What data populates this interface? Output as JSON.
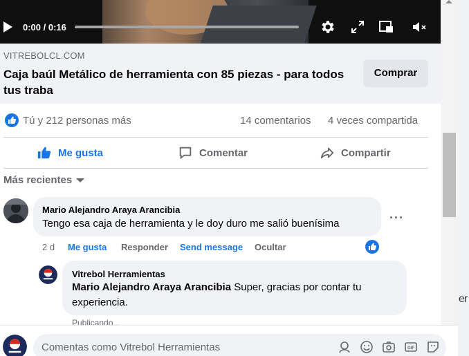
{
  "video": {
    "time": "0:00 / 0:16",
    "progress": 0.0
  },
  "link_preview": {
    "domain": "VITREBOLCL.COM",
    "title": "Caja baúl Metálico de herramienta con 85 piezas - para todos tus traba",
    "buy_label": "Comprar"
  },
  "stats": {
    "reactions_text": "Tú y 212 personas más",
    "comments": "14 comentarios",
    "shares": "4 veces compartida"
  },
  "actions": {
    "like": "Me gusta",
    "comment": "Comentar",
    "share": "Compartir"
  },
  "sort_label": "Más recientes",
  "comments": [
    {
      "author": "Mario Alejandro Araya Arancibia",
      "text": "Tengo esa caja de herramienta y le doy duro me salió buenísima",
      "time": "2 d",
      "like": "Me gusta",
      "reply": "Responder",
      "send": "Send message",
      "hide": "Ocultar",
      "more": "···"
    }
  ],
  "reply": {
    "author": "Vitrebol Herramientas",
    "mention": "Mario Alejandro Araya Arancibia",
    "text_line1": " Super, gracias por contar tu",
    "text_line2": "experiencia.",
    "status": "Publicando..."
  },
  "composer": {
    "placeholder": "Comentas como Vitrebol Herramientas"
  },
  "side_text": "er",
  "colors": {
    "accent": "#1b74e4",
    "secondary_text": "#65676b",
    "bubble": "#f0f2f5"
  }
}
